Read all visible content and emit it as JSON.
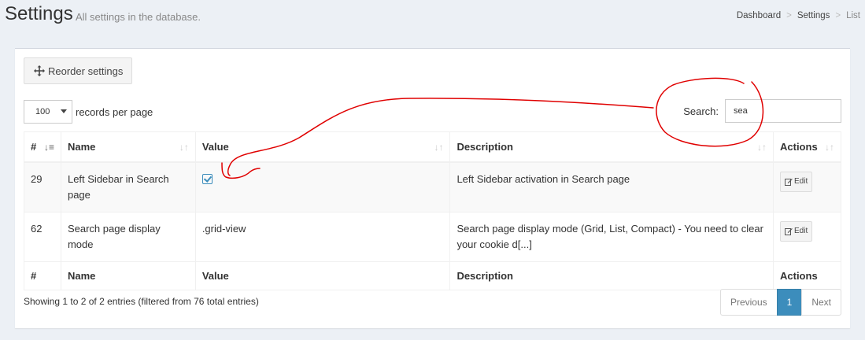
{
  "header": {
    "title": "Settings",
    "subtitle": "All settings in the database."
  },
  "breadcrumb": {
    "items": [
      "Dashboard",
      "Settings",
      "List"
    ],
    "separator": ">"
  },
  "toolbar": {
    "reorder_label": "Reorder settings"
  },
  "length": {
    "value": "100",
    "suffix": "records per page"
  },
  "search": {
    "label": "Search:",
    "value": "sea"
  },
  "table": {
    "columns": [
      "#",
      "Name",
      "Value",
      "Description",
      "Actions"
    ],
    "rows": [
      {
        "id": "29",
        "name": "Left Sidebar in Search page",
        "value": "",
        "value_checked": true,
        "description": "Left Sidebar activation in Search page",
        "action": "Edit"
      },
      {
        "id": "62",
        "name": "Search page display mode",
        "value": ".grid-view",
        "value_checked": false,
        "description": "Search page display mode (Grid, List, Compact) - You need to clear your cookie d[...]",
        "action": "Edit"
      }
    ]
  },
  "footer": {
    "info": "Showing 1 to 2 of 2 entries (filtered from 76 total entries)"
  },
  "pagination": {
    "previous": "Previous",
    "current": "1",
    "next": "Next"
  },
  "colors": {
    "primary": "#3c8dbc",
    "annotation": "#e00000"
  }
}
